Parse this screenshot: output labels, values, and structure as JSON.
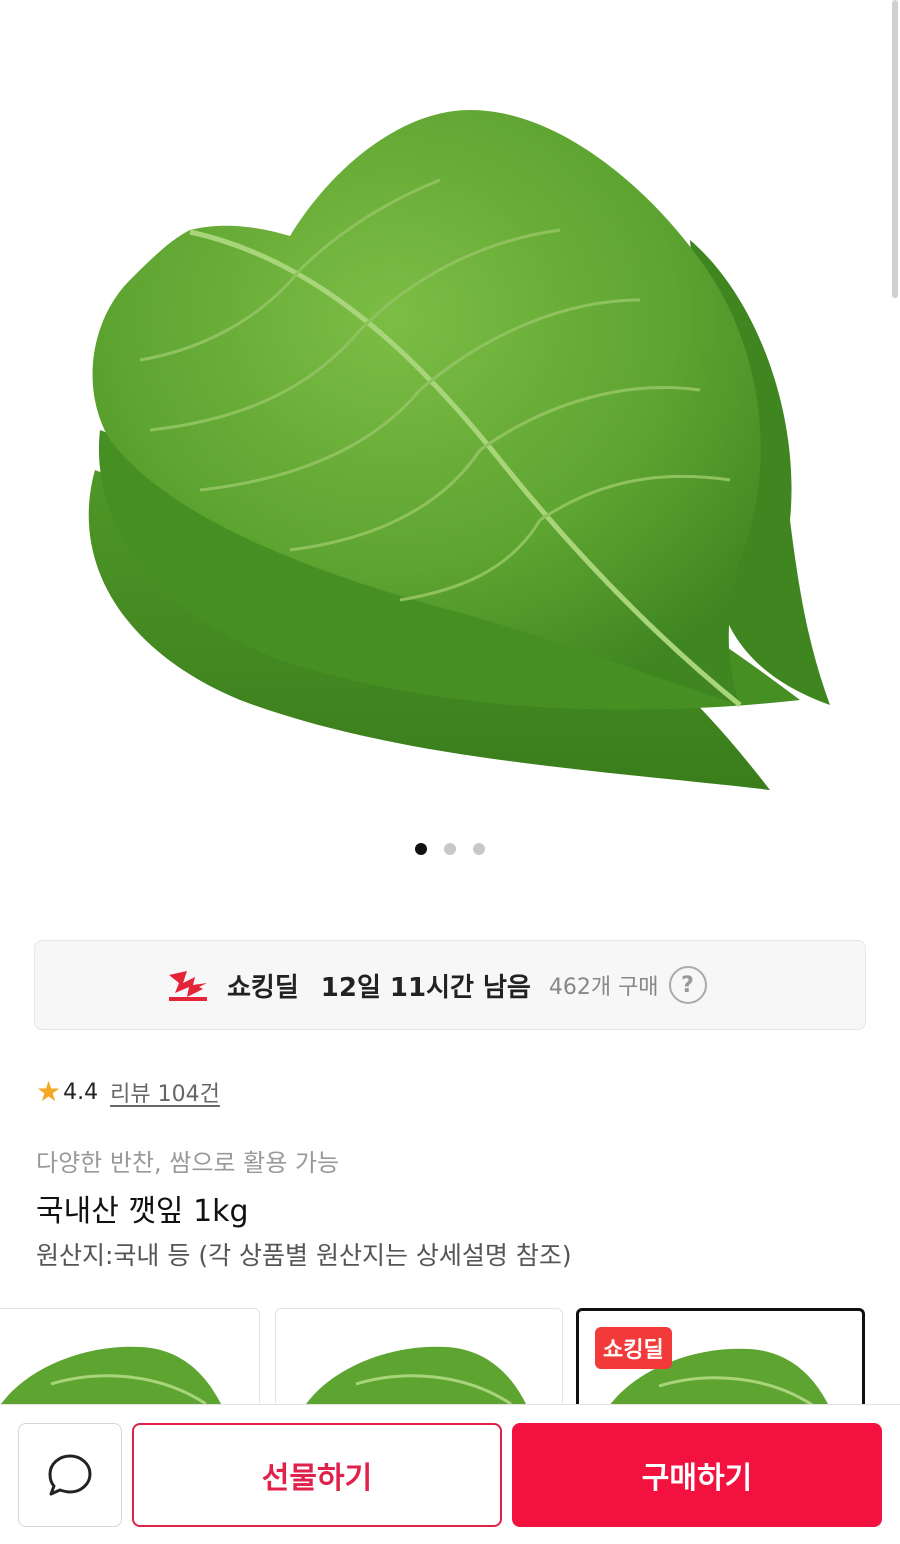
{
  "product_image": {
    "icon": "perilla-leaf-image",
    "slide_count": 3,
    "active_slide": 1
  },
  "deal": {
    "icon": "shocking-deal-lightning-icon",
    "name": "쇼킹딜",
    "remaining": "12일 11시간 남음",
    "purchase_count": "462개 구매",
    "help": "?"
  },
  "rating": {
    "star": "★",
    "value": "4.4",
    "review_link": "리뷰 104건"
  },
  "product": {
    "subtitle": "다양한 반찬, 쌈으로 활용 가능",
    "title": "국내산 깻잎 1kg",
    "origin": "원산지:국내 등 (각 상품별 원산지는 상세설명 참조)"
  },
  "options": [
    {
      "badge": ""
    },
    {
      "badge": ""
    },
    {
      "badge": "쇼킹딜",
      "selected": true
    }
  ],
  "bottom_bar": {
    "gift_label": "선물하기",
    "buy_label": "구매하기",
    "chat_icon": "chat-bubble-icon"
  },
  "colors": {
    "accent_red": "#f3123f",
    "gift_border": "#e0224a",
    "star": "#f5a623",
    "deal_red": "#e5243a"
  }
}
